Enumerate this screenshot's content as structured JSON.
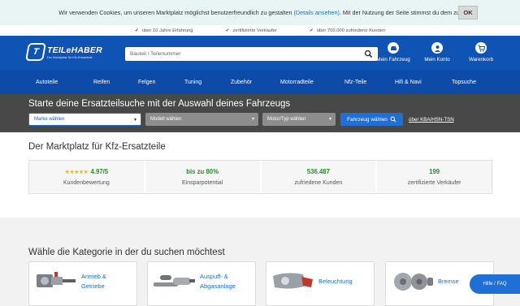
{
  "cookie": {
    "text_before": "Wir verwenden Cookies, um unseren Marktplatz möglichst benutzerfreundlich zu gestalten ",
    "link": "(Details ansehen)",
    "text_after": ". Mit der Nutzung der Seite stimmst du dem zu.",
    "ok_label": "OK"
  },
  "trust": [
    "über 10 Jahre Erfahrung",
    "zertifizierte Verkäufer",
    "über 700.000 zufriedene Kunden"
  ],
  "header": {
    "logo_name": "TEILeHABER",
    "logo_sub": "Der Marktplatz für Kfz-Ersatzteile",
    "search_placeholder": "Bauteil / Teilenummer",
    "icons": [
      {
        "label": "Mein Fahrzeug",
        "icon": "car-icon"
      },
      {
        "label": "Mein Konto",
        "icon": "user-icon"
      },
      {
        "label": "Warenkorb",
        "icon": "cart-icon"
      }
    ]
  },
  "nav": [
    "Autoteile",
    "Reifen",
    "Felgen",
    "Tuning",
    "Zubehör",
    "Motorradteile",
    "Nfz-Teile",
    "Hifi & Navi",
    "Topsuche"
  ],
  "vehicle": {
    "title": "Starte deine Ersatzteilsuche mit der Auswahl deines Fahrzeugs",
    "brand": "Marke wählen",
    "model": "Modell wählen",
    "engine": "Motor/Typ wählen",
    "button": "Fahrzeug wählen",
    "link": "über KBA/HSN-TSN"
  },
  "market": {
    "title": "Der Marktplatz für Kfz-Ersatzteile",
    "stats": [
      {
        "value": "4.97/5",
        "label": "Kundenbewertung",
        "stars": "★★★★★"
      },
      {
        "value": "bis zu 80%",
        "label": "Einsparpotential"
      },
      {
        "value": "536.487",
        "label": "zufriedene Kunden"
      },
      {
        "value": "199",
        "label": "zertifizierte Verkäufer"
      }
    ]
  },
  "categories": {
    "title": "Wähle die Kategorie in der du suchen möchtest",
    "items": [
      {
        "label1": "Antrieb &",
        "label2": "Getriebe"
      },
      {
        "label1": "Auspuff- &",
        "label2": "Abgasanlage"
      },
      {
        "label1": "Beleuchtung",
        "label2": ""
      },
      {
        "label1": "Bremse",
        "label2": ""
      }
    ]
  },
  "help": "Hilfe / FAQ",
  "colors": {
    "brand_blue": "#0f53b4",
    "accent_blue": "#1f6fd6",
    "green": "#2a8a2a",
    "star": "#f2b600"
  }
}
